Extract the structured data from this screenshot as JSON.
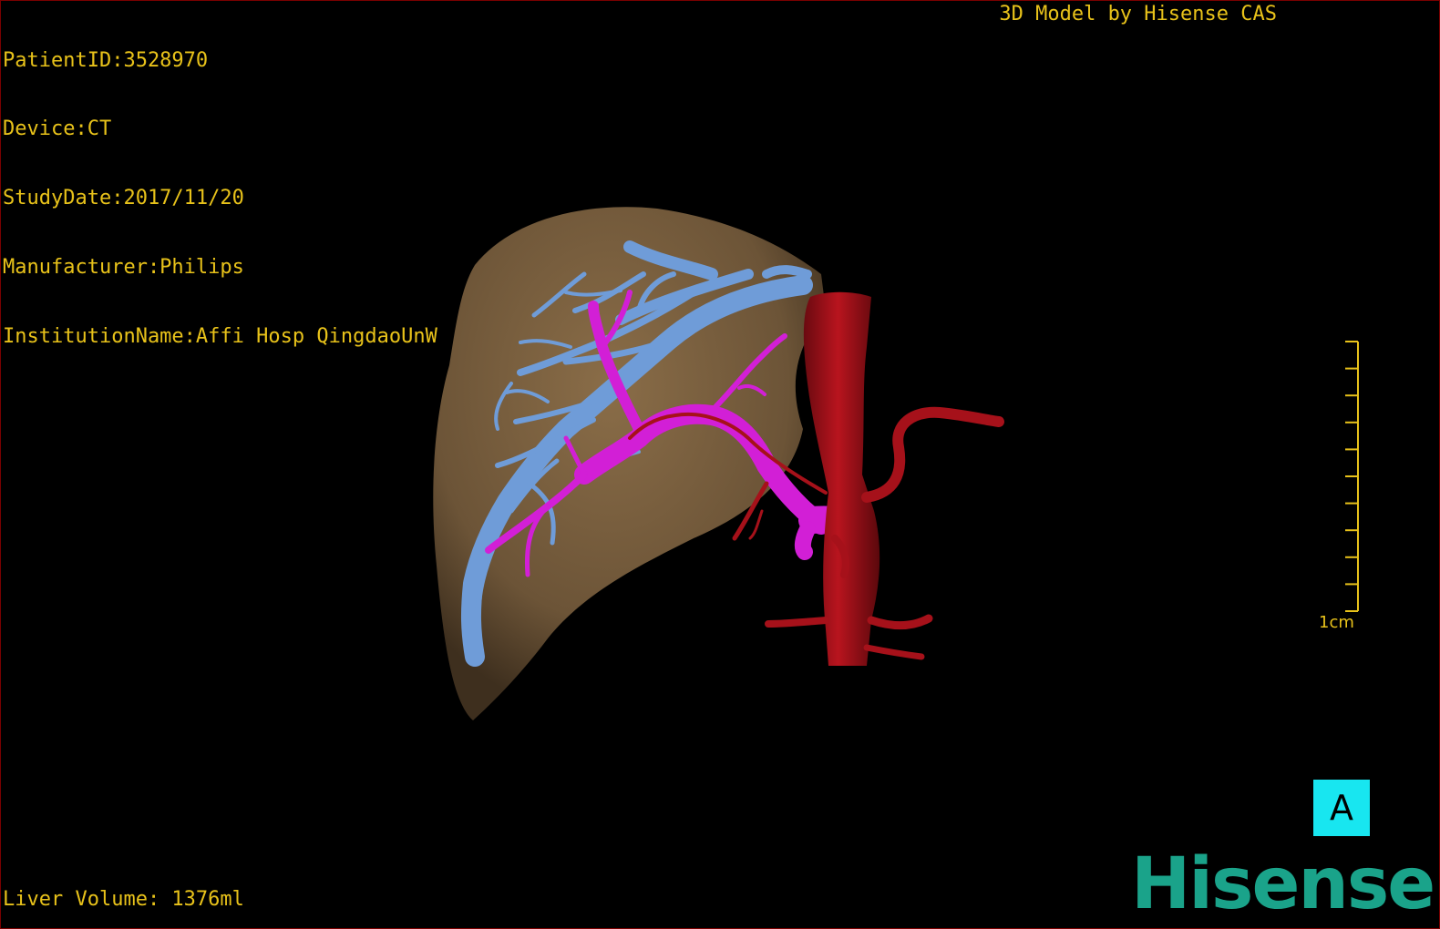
{
  "info": {
    "patient_id": "PatientID:3528970",
    "device": "Device:CT",
    "study_date": "StudyDate:2017/11/20",
    "manufacturer": "Manufacturer:Philips",
    "institution": "InstitutionName:Affi Hosp QingdaoUnW"
  },
  "brand_text": "3D Model by Hisense CAS",
  "liver_volume": "Liver Volume: 1376ml",
  "scale_bar": {
    "label": "1cm",
    "ticks": 10
  },
  "orientation_marker": "A",
  "logo_lettering": "Hisense",
  "colors": {
    "text": "#e8c21a",
    "liver": "#7a6040",
    "hepatic_vein": "#6f9cd8",
    "portal_vein": "#d21fd6",
    "artery": "#a6111a",
    "orientation_bg": "#18e6f0",
    "logo": "#1aa38a"
  }
}
